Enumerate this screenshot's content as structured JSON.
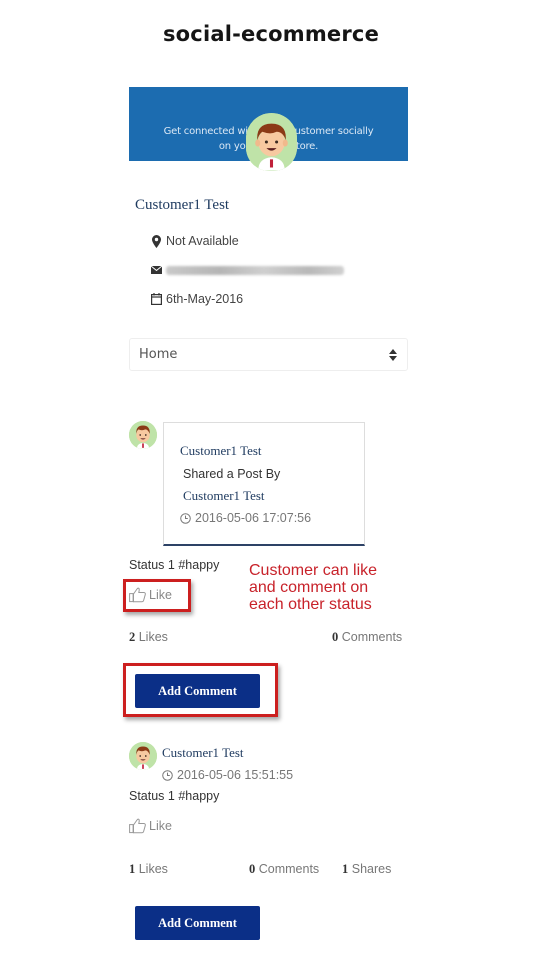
{
  "app": {
    "title": "social-ecommerce"
  },
  "banner": {
    "line1": "Get connected with other customer socially",
    "line2": "on your online store."
  },
  "profile": {
    "name": "Customer1 Test",
    "location": "Not Available",
    "email": "(email hidden/blurred)",
    "joined": "6th-May-2016",
    "icons": {
      "location": "map-marker-icon",
      "email": "envelope-icon",
      "joined": "calendar-icon"
    }
  },
  "nav_select": {
    "selected": "Home"
  },
  "posts": [
    {
      "shared_card": {
        "author": "Customer1 Test",
        "action": "Shared a Post By",
        "original_author": "Customer1 Test",
        "timestamp": "2016-05-06 17:07:56"
      },
      "status": "Status 1 #happy",
      "like_label": "Like",
      "likes_count": "2",
      "likes_label": "Likes",
      "comments_count": "0",
      "comments_label": "Comments",
      "add_comment_label": "Add Comment"
    },
    {
      "author": "Customer1 Test",
      "timestamp": "2016-05-06 15:51:55",
      "status": "Status 1 #happy",
      "like_label": "Like",
      "likes_count": "1",
      "likes_label": "Likes",
      "comments_count": "0",
      "comments_label": "Comments",
      "shares_count": "1",
      "shares_label": "Shares",
      "add_comment_label": "Add Comment"
    }
  ],
  "annotation": {
    "text_line1": "Customer can like",
    "text_line2": "and comment on",
    "text_line3": "each other status",
    "color": "#c8222a"
  },
  "colors": {
    "banner": "#1c6cb0",
    "button": "#0b2f87",
    "name_link": "#1e3a5f",
    "highlight": "#cc1f1f"
  }
}
